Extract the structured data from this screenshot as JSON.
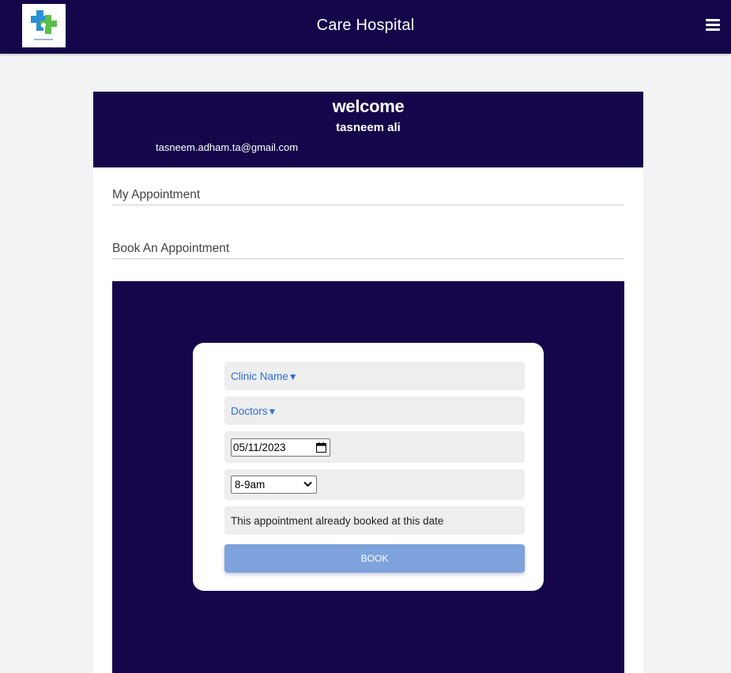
{
  "header": {
    "title": "Care Hospital",
    "logo_icon": "medical-cross-logo",
    "menu_icon": "hamburger-menu-icon"
  },
  "profile": {
    "welcome": "welcome",
    "name": "tasneem ali",
    "email": "tasneem.adham.ta@gmail.com"
  },
  "sections": {
    "my_appointment": "My Appointment",
    "book_appointment": "Book An Appointment"
  },
  "booking_form": {
    "clinic_label": "Clinic Name",
    "doctor_label": "Doctors",
    "dropdown_arrow": "▼",
    "date_value": "05/11/2023",
    "time_value": "8-9am",
    "status_message": "This appointment already booked at this date",
    "book_label": "BOOK"
  },
  "colors": {
    "navy": "#15054a",
    "link_blue": "#2b6fd6",
    "button_blue": "#7ea2db",
    "field_gray": "#eeeeee"
  }
}
